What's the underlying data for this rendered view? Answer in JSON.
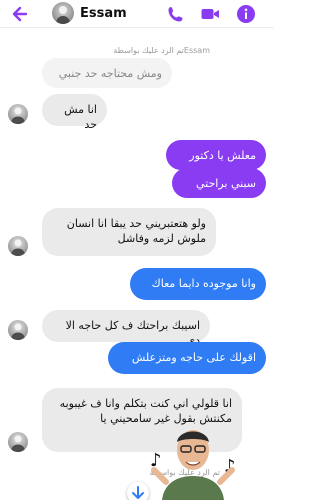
{
  "header": {
    "contact_name": "Essam",
    "accent_color": "#8a3cf2",
    "icons": [
      "back-arrow-icon",
      "phone-icon",
      "video-camera-icon",
      "info-icon"
    ]
  },
  "messages": [
    {
      "type": "reply_note",
      "text": "Essamتم الرد عليك بواسطة"
    },
    {
      "type": "quoted",
      "text": "ومش محتاجه حد جنبي"
    },
    {
      "type": "incoming",
      "text": "انا مش حد"
    },
    {
      "type": "outgoing",
      "color": "purple",
      "text": "معلش يا دكتور"
    },
    {
      "type": "outgoing",
      "color": "purple",
      "text": "سبني براحتي"
    },
    {
      "type": "incoming",
      "text": "ولو هتعتبريني حد يبقا انا انسان ملوش لزمه وفاشل"
    },
    {
      "type": "outgoing",
      "color": "blue",
      "text": "وانا موجوده دايما معاك"
    },
    {
      "type": "incoming",
      "text": "اسيبك براحتك ف كل حاجه الا دي"
    },
    {
      "type": "outgoing",
      "color": "blue",
      "text": "اقولك على حاجه ومتزعلش"
    },
    {
      "type": "incoming",
      "text": "انا قلولي اني كنت بتكلم وانا ف غيبوبه مكنتش بقول غير سامحيني يا"
    },
    {
      "type": "reply_note",
      "text": "تم الرد عليك بواسطة"
    }
  ],
  "scroll_button": {
    "icon": "arrow-down-icon"
  },
  "sticker": {
    "icon": "avatar-sticker-dancing-icon"
  }
}
